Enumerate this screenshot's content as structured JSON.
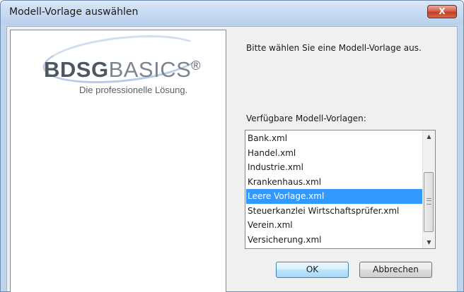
{
  "window": {
    "title": "Modell-Vorlage auswählen",
    "close_glyph": "X"
  },
  "logo": {
    "part_bold": "BDSG",
    "part_light": "BASICS",
    "registered": "®",
    "tagline": "Die professionelle Lösung."
  },
  "prompt": "Bitte wählen Sie eine Modell-Vorlage aus.",
  "template_list": {
    "label": "Verfügbare Modell-Vorlagen:",
    "items": [
      "Bank.xml",
      "Handel.xml",
      "Industrie.xml",
      "Krankenhaus.xml",
      "Leere Vorlage.xml",
      "Steuerkanzlei Wirtschaftsprüfer.xml",
      "Verein.xml",
      "Versicherung.xml"
    ],
    "selected": "Leere Vorlage.xml"
  },
  "buttons": {
    "ok": "OK",
    "cancel": "Abbrechen"
  },
  "colors": {
    "selection": "#3399ff",
    "close_button": "#c13d23",
    "title_bar": "#c9dcf2"
  }
}
